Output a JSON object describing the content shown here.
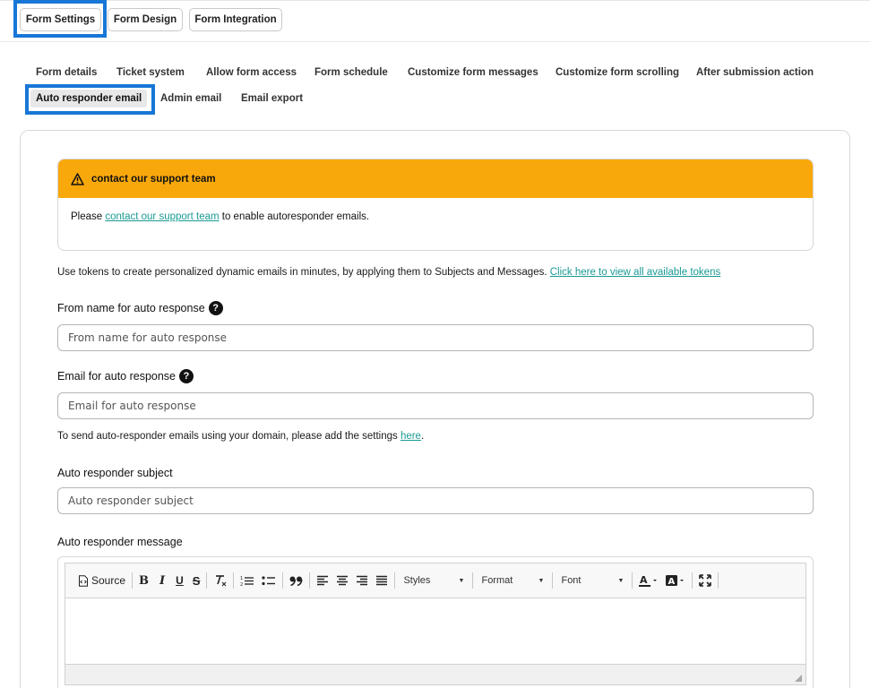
{
  "top_tabs": [
    {
      "label": "Form Settings",
      "active": true
    },
    {
      "label": "Form Design",
      "active": false
    },
    {
      "label": "Form Integration",
      "active": false
    }
  ],
  "sub_tabs": [
    {
      "label": "Form details"
    },
    {
      "label": "Ticket system"
    },
    {
      "label": "Allow form access"
    },
    {
      "label": "Form schedule"
    },
    {
      "label": "Customize form messages"
    },
    {
      "label": "Customize form scrolling"
    },
    {
      "label": "After submission action"
    },
    {
      "label": "Auto responder email",
      "active": true
    },
    {
      "label": "Admin email"
    },
    {
      "label": "Email export"
    }
  ],
  "alert": {
    "title": "contact our support team",
    "body_prefix": "Please ",
    "body_link": "contact our support team",
    "body_suffix": " to enable autoresponder emails.",
    "icon": "warning-icon"
  },
  "tokens_note": {
    "text": "Use tokens to create personalized dynamic emails in minutes, by applying them to Subjects and Messages. ",
    "link": "Click here to view all available tokens"
  },
  "fields": {
    "from_name": {
      "label": "From name for auto response",
      "placeholder": "From name for auto response"
    },
    "email": {
      "label": "Email for auto response",
      "placeholder": "Email for auto response"
    },
    "subject": {
      "label": "Auto responder subject",
      "placeholder": "Auto responder subject"
    },
    "message": {
      "label": "Auto responder message"
    }
  },
  "domain_note": {
    "text": "To send auto-responder emails using your domain, please add the settings ",
    "link": "here",
    "suffix": "."
  },
  "editor": {
    "source_label": "Source",
    "bold": "B",
    "italic": "I",
    "underline": "U",
    "strike": "S",
    "styles_label": "Styles",
    "format_label": "Format",
    "font_label": "Font"
  },
  "colors": {
    "accent": "#1877d6",
    "alert_bg": "#f9a80b",
    "link": "#1a9a94"
  }
}
